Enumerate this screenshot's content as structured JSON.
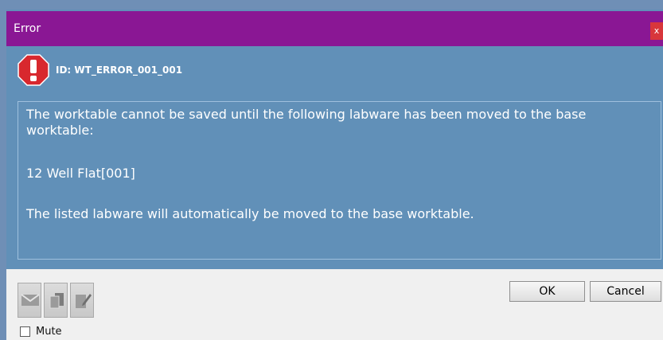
{
  "window": {
    "title": "Error",
    "close_label": "x"
  },
  "error": {
    "icon": "error-exclamation-icon",
    "id_text": "ID: WT_ERROR_001_001"
  },
  "message": {
    "line1": "The worktable cannot be saved until the following labware has been moved to the base",
    "line2": "worktable:",
    "line3": "12 Well Flat[001]",
    "line4": "The listed labware will automatically be moved to the base worktable."
  },
  "footer": {
    "tools": [
      "email-icon",
      "copy-icon",
      "edit-note-icon"
    ],
    "mute_label": "Mute",
    "mute_checked": false,
    "ok_label": "OK",
    "cancel_label": "Cancel"
  },
  "colors": {
    "titlebar": "#8a1794",
    "panel": "#6190b8",
    "close": "#d8363b",
    "footer": "#f0f0f0"
  }
}
